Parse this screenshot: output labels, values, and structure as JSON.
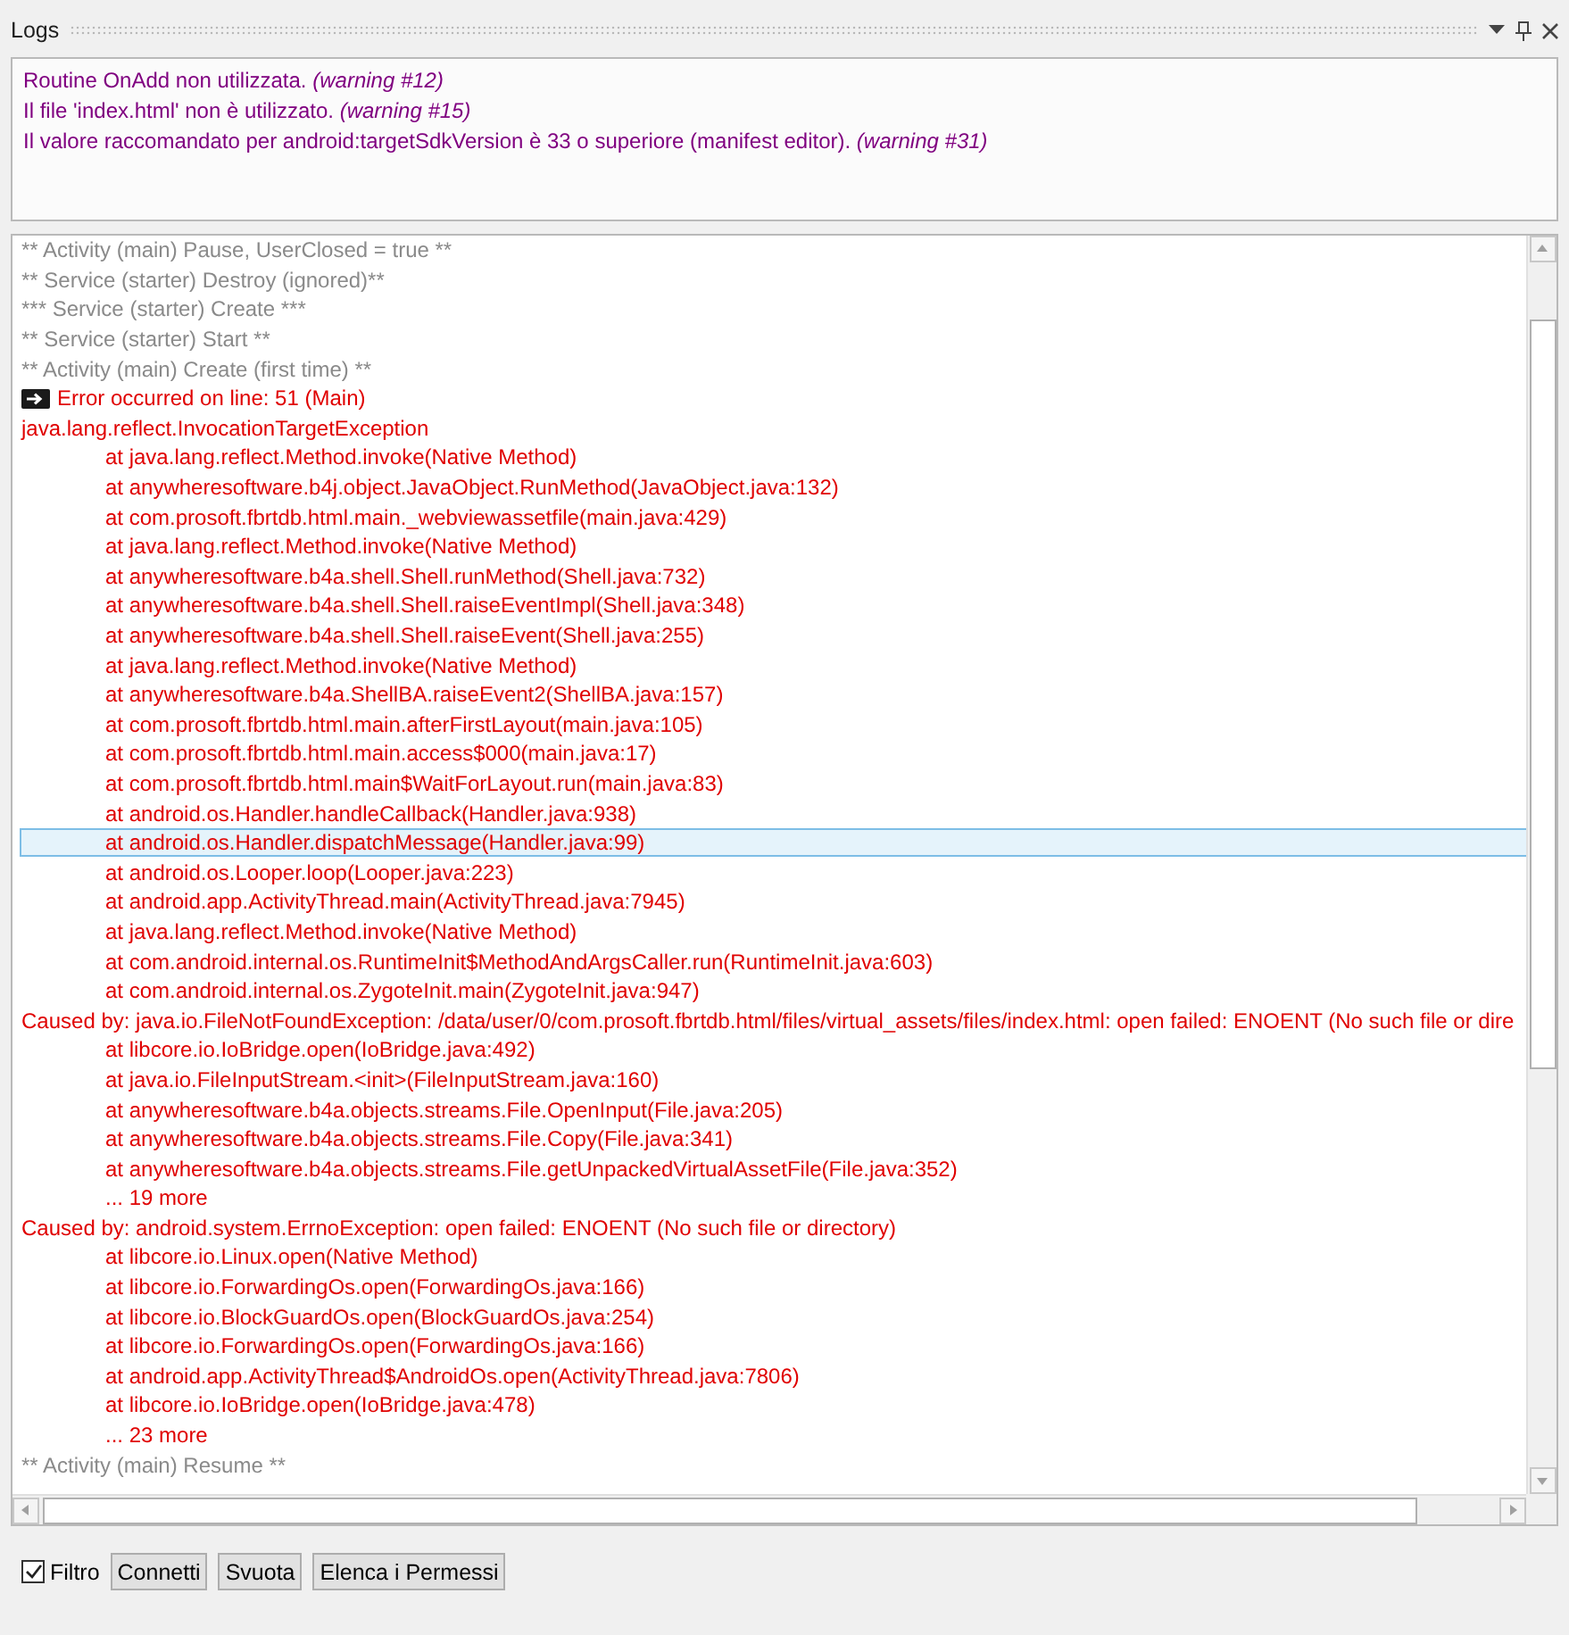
{
  "panel": {
    "title": "Logs"
  },
  "warnings": [
    "Routine OnAdd non utilizzata. *(warning #12)*",
    "Il file 'index.html' non è utilizzato. *(warning #15)*",
    "Il valore raccomandato per android:targetSdkVersion è 33 o superiore (manifest editor). *(warning #31)*"
  ],
  "log_lines": [
    {
      "kind": "info",
      "text": "** Activity (main) Pause, UserClosed = true **",
      "selected": false
    },
    {
      "kind": "info",
      "text": "** Service (starter) Destroy (ignored)**",
      "selected": false
    },
    {
      "kind": "info",
      "text": "*** Service (starter) Create ***",
      "selected": false
    },
    {
      "kind": "info",
      "text": "** Service (starter) Start **",
      "selected": false
    },
    {
      "kind": "info",
      "text": "** Activity (main) Create (first time) **",
      "selected": false
    },
    {
      "kind": "marker",
      "text": "Error occurred on line: 51 (Main)",
      "selected": false
    },
    {
      "kind": "error",
      "text": "java.lang.reflect.InvocationTargetException",
      "selected": false
    },
    {
      "kind": "frame",
      "text": "at java.lang.reflect.Method.invoke(Native Method)",
      "selected": false
    },
    {
      "kind": "frame",
      "text": "at anywheresoftware.b4j.object.JavaObject.RunMethod(JavaObject.java:132)",
      "selected": false
    },
    {
      "kind": "frame",
      "text": "at com.prosoft.fbrtdb.html.main._webviewassetfile(main.java:429)",
      "selected": false
    },
    {
      "kind": "frame",
      "text": "at java.lang.reflect.Method.invoke(Native Method)",
      "selected": false
    },
    {
      "kind": "frame",
      "text": "at anywheresoftware.b4a.shell.Shell.runMethod(Shell.java:732)",
      "selected": false
    },
    {
      "kind": "frame",
      "text": "at anywheresoftware.b4a.shell.Shell.raiseEventImpl(Shell.java:348)",
      "selected": false
    },
    {
      "kind": "frame",
      "text": "at anywheresoftware.b4a.shell.Shell.raiseEvent(Shell.java:255)",
      "selected": false
    },
    {
      "kind": "frame",
      "text": "at java.lang.reflect.Method.invoke(Native Method)",
      "selected": false
    },
    {
      "kind": "frame",
      "text": "at anywheresoftware.b4a.ShellBA.raiseEvent2(ShellBA.java:157)",
      "selected": false
    },
    {
      "kind": "frame",
      "text": "at com.prosoft.fbrtdb.html.main.afterFirstLayout(main.java:105)",
      "selected": false
    },
    {
      "kind": "frame",
      "text": "at com.prosoft.fbrtdb.html.main.access$000(main.java:17)",
      "selected": false
    },
    {
      "kind": "frame",
      "text": "at com.prosoft.fbrtdb.html.main$WaitForLayout.run(main.java:83)",
      "selected": false
    },
    {
      "kind": "frame",
      "text": "at android.os.Handler.handleCallback(Handler.java:938)",
      "selected": false
    },
    {
      "kind": "frame",
      "text": "at android.os.Handler.dispatchMessage(Handler.java:99)",
      "selected": true
    },
    {
      "kind": "frame",
      "text": "at android.os.Looper.loop(Looper.java:223)",
      "selected": false
    },
    {
      "kind": "frame",
      "text": "at android.app.ActivityThread.main(ActivityThread.java:7945)",
      "selected": false
    },
    {
      "kind": "frame",
      "text": "at java.lang.reflect.Method.invoke(Native Method)",
      "selected": false
    },
    {
      "kind": "frame",
      "text": "at com.android.internal.os.RuntimeInit$MethodAndArgsCaller.run(RuntimeInit.java:603)",
      "selected": false
    },
    {
      "kind": "frame",
      "text": "at com.android.internal.os.ZygoteInit.main(ZygoteInit.java:947)",
      "selected": false
    },
    {
      "kind": "error",
      "text": "Caused by: java.io.FileNotFoundException: /data/user/0/com.prosoft.fbrtdb.html/files/virtual_assets/files/index.html: open failed: ENOENT (No such file or dire",
      "selected": false
    },
    {
      "kind": "frame",
      "text": "at libcore.io.IoBridge.open(IoBridge.java:492)",
      "selected": false
    },
    {
      "kind": "frame",
      "text": "at java.io.FileInputStream.<init>(FileInputStream.java:160)",
      "selected": false
    },
    {
      "kind": "frame",
      "text": "at anywheresoftware.b4a.objects.streams.File.OpenInput(File.java:205)",
      "selected": false
    },
    {
      "kind": "frame",
      "text": "at anywheresoftware.b4a.objects.streams.File.Copy(File.java:341)",
      "selected": false
    },
    {
      "kind": "frame",
      "text": "at anywheresoftware.b4a.objects.streams.File.getUnpackedVirtualAssetFile(File.java:352)",
      "selected": false
    },
    {
      "kind": "frame",
      "text": "... 19 more",
      "selected": false
    },
    {
      "kind": "error",
      "text": "Caused by: android.system.ErrnoException: open failed: ENOENT (No such file or directory)",
      "selected": false
    },
    {
      "kind": "frame",
      "text": "at libcore.io.Linux.open(Native Method)",
      "selected": false
    },
    {
      "kind": "frame",
      "text": "at libcore.io.ForwardingOs.open(ForwardingOs.java:166)",
      "selected": false
    },
    {
      "kind": "frame",
      "text": "at libcore.io.BlockGuardOs.open(BlockGuardOs.java:254)",
      "selected": false
    },
    {
      "kind": "frame",
      "text": "at libcore.io.ForwardingOs.open(ForwardingOs.java:166)",
      "selected": false
    },
    {
      "kind": "frame",
      "text": "at android.app.ActivityThread$AndroidOs.open(ActivityThread.java:7806)",
      "selected": false
    },
    {
      "kind": "frame",
      "text": "at libcore.io.IoBridge.open(IoBridge.java:478)",
      "selected": false
    },
    {
      "kind": "frame",
      "text": "... 23 more",
      "selected": false
    },
    {
      "kind": "info",
      "text": "** Activity (main) Resume **",
      "selected": false
    }
  ],
  "filter": {
    "label": "Filtro",
    "checked": true
  },
  "buttons": [
    "Connetti",
    "Svuota",
    "Elenca i Permessi"
  ]
}
